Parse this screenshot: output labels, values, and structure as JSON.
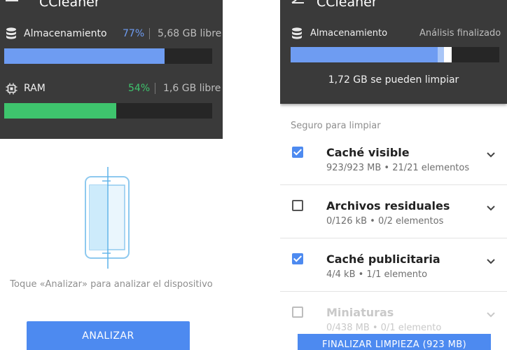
{
  "left": {
    "app_title": "CCleaner",
    "storage": {
      "label": "Almacenamiento",
      "percent": "77%",
      "free": "5,68 GB libre",
      "fill": 0.77,
      "color": "#6e9cf2"
    },
    "ram": {
      "label": "RAM",
      "percent": "54%",
      "free": "1,6 GB libre",
      "fill": 0.54,
      "color": "#3ec46d"
    },
    "hint": "Toque «Analizar» para analizar el dispositivo",
    "analyze_button": "ANALIZAR"
  },
  "right": {
    "app_title": "CCleaner",
    "storage_label": "Almacenamiento",
    "analysis_status": "Análisis finalizado",
    "cleanable": "1,72 GB se pueden limpiar",
    "section_label": "Seguro para limpiar",
    "items": [
      {
        "title": "Caché visible",
        "subtitle": "923/923 MB • 21/21 elementos",
        "checked": true
      },
      {
        "title": "Archivos residuales",
        "subtitle": "0/126 kB • 0/2 elementos",
        "checked": false
      },
      {
        "title": "Caché publicitaria",
        "subtitle": "4/4 kB • 1/1 elemento",
        "checked": true
      },
      {
        "title": "Miniaturas",
        "subtitle": "0/438 MB • 0/1 elemento",
        "checked": false
      }
    ],
    "finish_button": "FINALIZAR LIMPIEZA (923 MB)"
  },
  "icons": {
    "menu": "hamburger-menu-icon",
    "back": "back-arrow-icon",
    "storage": "database-icon",
    "ram": "chip-icon",
    "phone": "phone-scan-icon",
    "expand": "chevron-down-icon"
  },
  "colors": {
    "header": "#3a3a3a",
    "accent_blue": "#4d8af0",
    "ram_green": "#3ec46d",
    "storage_blue": "#6e9cf2"
  }
}
